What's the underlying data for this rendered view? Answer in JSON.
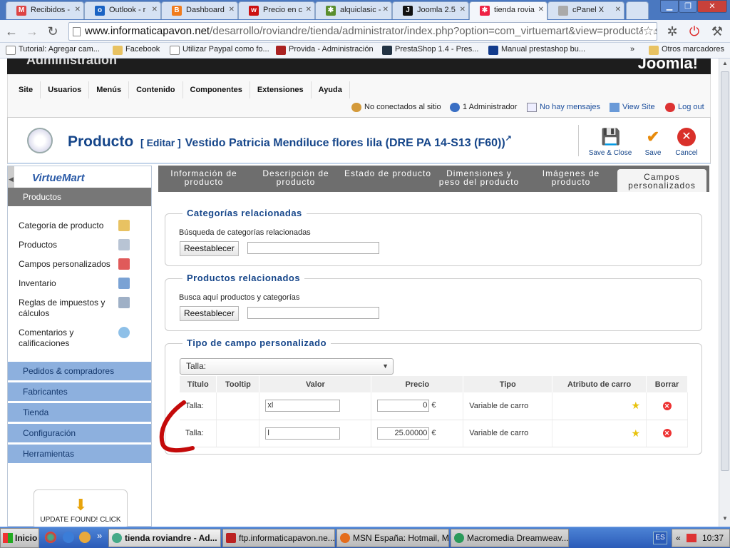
{
  "browser": {
    "tabs": [
      {
        "title": "Recibidos -",
        "color": "#d44"
      },
      {
        "title": "Outlook - r",
        "color": "#1a63c4"
      },
      {
        "title": "Dashboard",
        "color": "#f17c1c"
      },
      {
        "title": "Precio en c",
        "color": "#c11"
      },
      {
        "title": "alquiclasic -",
        "color": "#5a8e2e"
      },
      {
        "title": "Joomla 2.5",
        "color": "#111"
      },
      {
        "title": "tienda rovia",
        "color": "#e24"
      },
      {
        "title": "cPanel X",
        "color": "#aaa"
      }
    ],
    "url_domain": "www.informaticapavon.net",
    "url_path": "/desarrollo/roviandre/tienda/administrator/index.php?option=com_virtuemart&view=product&task=e",
    "bookmarks": [
      "Tutorial: Agregar cam...",
      "Facebook",
      "Utilizar Paypal como fo...",
      "Provida - Administración",
      "PrestaShop 1.4 - Pres...",
      "Manual prestashop bu..."
    ],
    "bookmarks_more": "»",
    "other_bookmarks": "Otros marcadores"
  },
  "admin": {
    "header_title": "Administration",
    "joomla_logo": "Joomla!",
    "menus": [
      "Site",
      "Usuarios",
      "Menús",
      "Contenido",
      "Componentes",
      "Extensiones",
      "Ayuda"
    ],
    "status": {
      "not_connected": "No conectados al sitio",
      "admins": "1 Administrador",
      "messages": "No hay mensajes",
      "view_site": "View Site",
      "logout": "Log out"
    }
  },
  "toolbar": {
    "title": "Producto",
    "edit": "[ Editar ]",
    "product_name": "Vestido Patricia Mendiluce flores lila (DRE PA 14-S13 (F60))",
    "save_close": "Save & Close",
    "save": "Save",
    "cancel": "Cancel"
  },
  "sidebar": {
    "logo": "VirtueMart",
    "active_section": "Productos",
    "items": [
      "Categoría de producto",
      "Productos",
      "Campos personalizados",
      "Inventario",
      "Reglas de impuestos y cálculos",
      "Comentarios y calificaciones"
    ],
    "sections": [
      "Pedidos & compradores",
      "Fabricantes",
      "Tienda",
      "Configuración",
      "Herramientas"
    ],
    "update_notice": "UPDATE FOUND! CLICK"
  },
  "content_tabs": [
    "Información de producto",
    "Descripción de producto",
    "Estado de producto",
    "Dimensiones y peso del producto",
    "Imágenes de producto",
    "Campos personalizados"
  ],
  "related_categories": {
    "legend": "Categorías relacionadas",
    "label": "Búsqueda de categorías relacionadas",
    "reset": "Reestablecer"
  },
  "related_products": {
    "legend": "Productos relacionados",
    "label": "Busca aquí productos y categorías",
    "reset": "Reestablecer"
  },
  "custom_fields": {
    "legend": "Tipo de campo personalizado",
    "select_value": "Talla:",
    "columns": [
      "Título",
      "Tooltip",
      "Valor",
      "Precio",
      "Tipo",
      "Atributo de carro",
      "Borrar"
    ],
    "rows": [
      {
        "title": "Talla:",
        "tooltip": "",
        "value": "xl",
        "price": "0",
        "currency": "€",
        "type": "Variable de carro"
      },
      {
        "title": "Talla:",
        "tooltip": "",
        "value": "l",
        "price": "25.00000",
        "currency": "€",
        "type": "Variable de carro"
      }
    ]
  },
  "taskbar": {
    "start": "Inicio",
    "items": [
      "tienda roviandre - Ad...",
      "ftp.informaticapavon.ne...",
      "MSN España: Hotmail, M...",
      "Macromedia Dreamweav..."
    ],
    "lang": "ES",
    "time": "10:37",
    "expand": "«"
  }
}
